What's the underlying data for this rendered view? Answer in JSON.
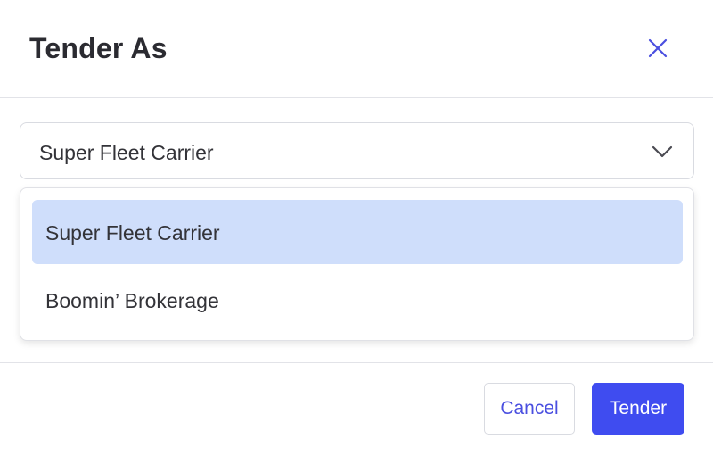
{
  "dialog": {
    "title": "Tender As",
    "close_icon": "close-icon"
  },
  "select": {
    "value": "Super Fleet Carrier",
    "chevron_icon": "chevron-down-icon",
    "options": [
      {
        "label": "Super Fleet Carrier",
        "selected": true
      },
      {
        "label": "Boomin’ Brokerage",
        "selected": false
      }
    ]
  },
  "footer": {
    "cancel_label": "Cancel",
    "tender_label": "Tender"
  },
  "colors": {
    "accent": "#3f4cf0",
    "selected_option_bg": "#cfdefb",
    "text": "#333338"
  }
}
